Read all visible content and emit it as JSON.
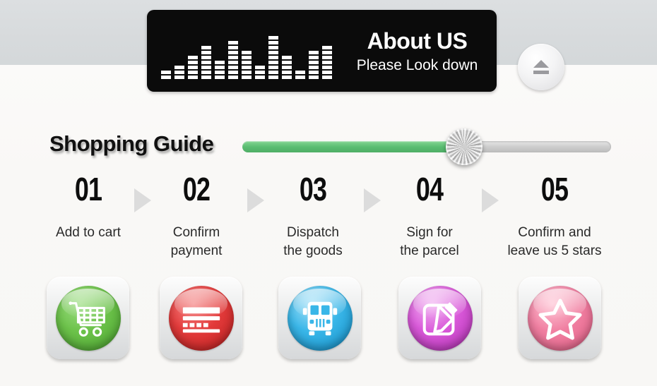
{
  "background": {
    "top_color": "#d8dbdd",
    "bottom_color": "#f9f8f6"
  },
  "banner": {
    "title": "About US",
    "subtitle": "Please Look down",
    "background_color": "#0b0b0b",
    "equalizer": {
      "segments": [
        2,
        3,
        5,
        7,
        4,
        8,
        6,
        3,
        9,
        5,
        2,
        6,
        7
      ],
      "bar_color": "#ffffff"
    }
  },
  "eject_button": {
    "label": "Eject"
  },
  "guide": {
    "title": "Shopping Guide",
    "slider": {
      "value": 59,
      "fill_color": "#5bbd72",
      "track_color": "#c8c8c8"
    }
  },
  "steps": [
    {
      "number": "01",
      "label_line1": "Add to cart",
      "label_line2": "",
      "icon": "shopping-cart-icon",
      "color": "#6cc24a"
    },
    {
      "number": "02",
      "label_line1": "Confirm",
      "label_line2": "payment",
      "icon": "credit-card-icon",
      "color": "#e33b3b"
    },
    {
      "number": "03",
      "label_line1": "Dispatch",
      "label_line2": "the goods",
      "icon": "delivery-truck-icon",
      "color": "#39b6e8"
    },
    {
      "number": "04",
      "label_line1": "Sign for",
      "label_line2": "the parcel",
      "icon": "sign-edit-icon",
      "color": "#d959d9"
    },
    {
      "number": "05",
      "label_line1": "Confirm and",
      "label_line2": "leave us 5 stars",
      "icon": "star-icon",
      "color": "#f07fa1"
    }
  ]
}
